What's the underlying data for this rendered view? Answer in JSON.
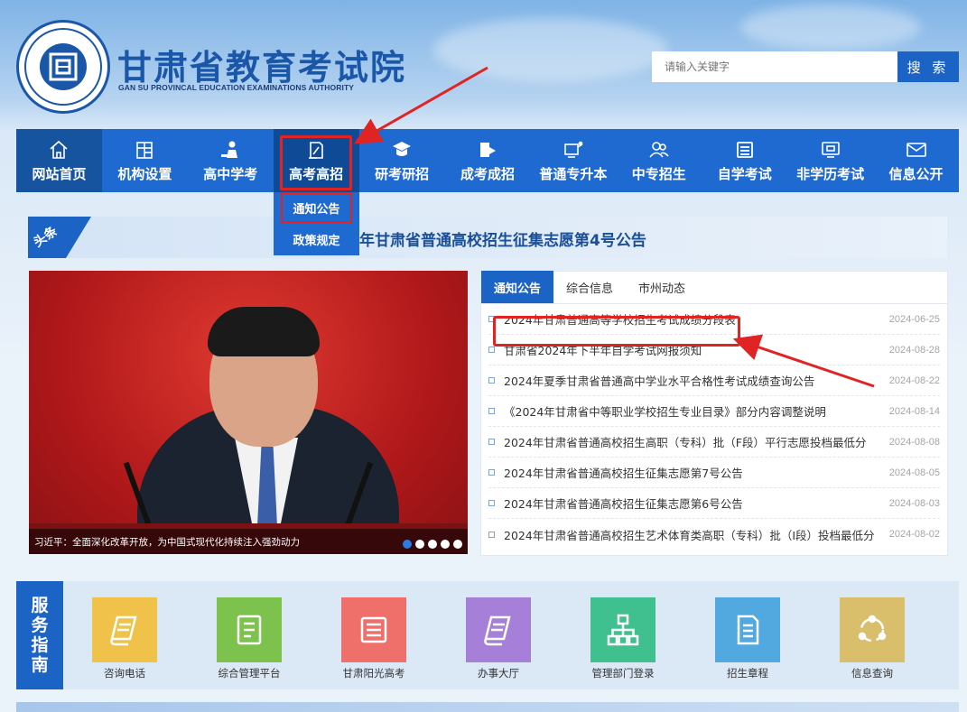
{
  "header": {
    "title": "甘肃省教育考试院",
    "subtitle": "GAN SU PROVINCAL EDUCATION EXAMINATIONS AUTHORITY",
    "search_placeholder": "请输入关键字",
    "search_label": "搜 索"
  },
  "nav": {
    "items": [
      {
        "label": "网站首页",
        "icon": "home-icon"
      },
      {
        "label": "机构设置",
        "icon": "building-icon"
      },
      {
        "label": "高中学考",
        "icon": "student-icon"
      },
      {
        "label": "高考高招",
        "icon": "document-pen-icon"
      },
      {
        "label": "研考研招",
        "icon": "graduation-cap-icon"
      },
      {
        "label": "成考成招",
        "icon": "flag-icon"
      },
      {
        "label": "普通专升本",
        "icon": "board-icon"
      },
      {
        "label": "中专招生",
        "icon": "people-icon"
      },
      {
        "label": "自学考试",
        "icon": "list-icon"
      },
      {
        "label": "非学历考试",
        "icon": "monitor-icon"
      },
      {
        "label": "信息公开",
        "icon": "mail-icon"
      }
    ],
    "dropdown": [
      "通知公告",
      "政策规定"
    ]
  },
  "headline": {
    "badge": "头条",
    "text": "年甘肃省普通高校招生征集志愿第4号公告"
  },
  "carousel": {
    "caption": "习近平：全面深化改革开放，为中国式现代化持续注入强劲动力"
  },
  "notice": {
    "tabs": [
      "通知公告",
      "综合信息",
      "市州动态"
    ],
    "rows": [
      {
        "title": "2024年甘肃普通高等学校招生考试成绩分段表",
        "date": "2024-06-25"
      },
      {
        "title": "甘肃省2024年下半年自学考试网报须知",
        "date": "2024-08-28"
      },
      {
        "title": "2024年夏季甘肃省普通高中学业水平合格性考试成绩查询公告",
        "date": "2024-08-22"
      },
      {
        "title": "《2024年甘肃省中等职业学校招生专业目录》部分内容调整说明",
        "date": "2024-08-14"
      },
      {
        "title": "2024年甘肃省普通高校招生高职（专科）批（F段）平行志愿投档最低分",
        "date": "2024-08-08"
      },
      {
        "title": "2024年甘肃省普通高校招生征集志愿第7号公告",
        "date": "2024-08-05"
      },
      {
        "title": "2024年甘肃省普通高校招生征集志愿第6号公告",
        "date": "2024-08-03"
      },
      {
        "title": "2024年甘肃省普通高校招生艺术体育类高职（专科）批（I段）投档最低分",
        "date": "2024-08-02"
      }
    ]
  },
  "services": {
    "label": [
      "服",
      "务",
      "指",
      "南"
    ],
    "items": [
      {
        "label": "咨询电话",
        "color": "#f0c24a",
        "icon": "scroll-icon"
      },
      {
        "label": "综合管理平台",
        "color": "#7cc24d",
        "icon": "notepad-icon"
      },
      {
        "label": "甘肃阳光高考",
        "color": "#ef6f6a",
        "icon": "list-doc-icon"
      },
      {
        "label": "办事大厅",
        "color": "#a57fd8",
        "icon": "scroll-icon"
      },
      {
        "label": "管理部门登录",
        "color": "#3fc08e",
        "icon": "org-chart-icon"
      },
      {
        "label": "招生章程",
        "color": "#52a9e0",
        "icon": "document-icon"
      },
      {
        "label": "信息查询",
        "color": "#d9bf6c",
        "icon": "share-icon"
      }
    ]
  }
}
